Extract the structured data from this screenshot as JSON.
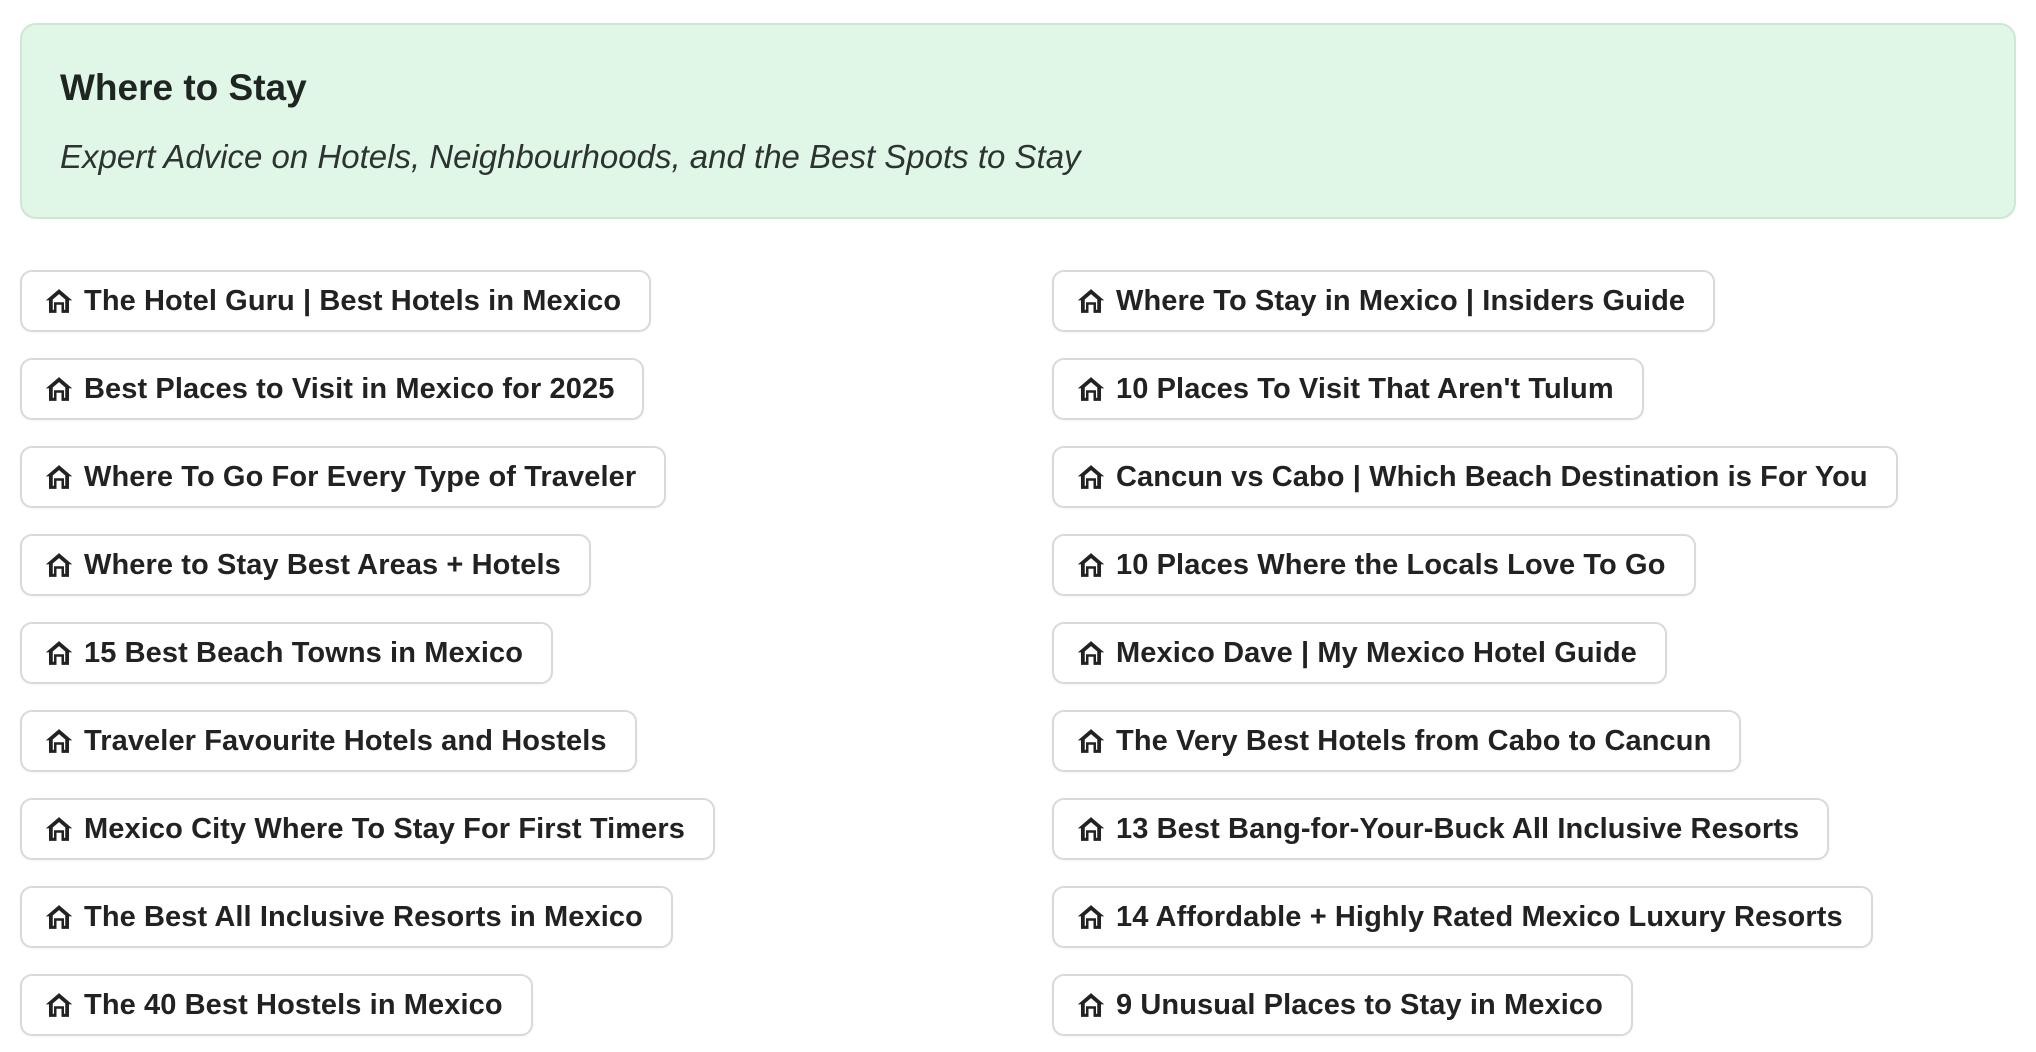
{
  "header": {
    "title": "Where to Stay",
    "subtitle": "Expert Advice on Hotels, Neighbourhoods, and the Best Spots to Stay"
  },
  "colors": {
    "header_bg": "#e0f7e7",
    "header_border": "#cde7d5",
    "pill_border": "#d8dad9",
    "text": "#222222"
  },
  "links": {
    "left": [
      {
        "icon": "home-icon",
        "label": "The Hotel Guru | Best Hotels in Mexico"
      },
      {
        "icon": "home-icon",
        "label": "Best Places to Visit in Mexico for 2025"
      },
      {
        "icon": "home-icon",
        "label": "Where To Go For Every Type of Traveler"
      },
      {
        "icon": "home-icon",
        "label": "Where to Stay Best Areas + Hotels"
      },
      {
        "icon": "home-icon",
        "label": "15 Best Beach Towns in Mexico"
      },
      {
        "icon": "home-icon",
        "label": "Traveler Favourite Hotels and Hostels"
      },
      {
        "icon": "home-icon",
        "label": "Mexico City Where To Stay For First Timers"
      },
      {
        "icon": "home-icon",
        "label": "The Best All Inclusive Resorts in Mexico"
      },
      {
        "icon": "home-icon",
        "label": "The 40 Best Hostels in Mexico"
      }
    ],
    "right": [
      {
        "icon": "home-icon",
        "label": "Where To Stay in Mexico | Insiders Guide"
      },
      {
        "icon": "home-icon",
        "label": "10 Places To Visit That Aren't Tulum"
      },
      {
        "icon": "home-icon",
        "label": "Cancun vs Cabo | Which Beach Destination is For You"
      },
      {
        "icon": "home-icon",
        "label": "10 Places Where the Locals Love To Go"
      },
      {
        "icon": "home-icon",
        "label": "Mexico Dave | My Mexico Hotel Guide"
      },
      {
        "icon": "home-icon",
        "label": "The Very Best Hotels from Cabo to Cancun"
      },
      {
        "icon": "home-icon",
        "label": "13 Best Bang-for-Your-Buck All Inclusive Resorts"
      },
      {
        "icon": "home-icon",
        "label": "14 Affordable + Highly Rated Mexico Luxury Resorts"
      },
      {
        "icon": "home-icon",
        "label": "9 Unusual Places to Stay in Mexico"
      }
    ]
  }
}
